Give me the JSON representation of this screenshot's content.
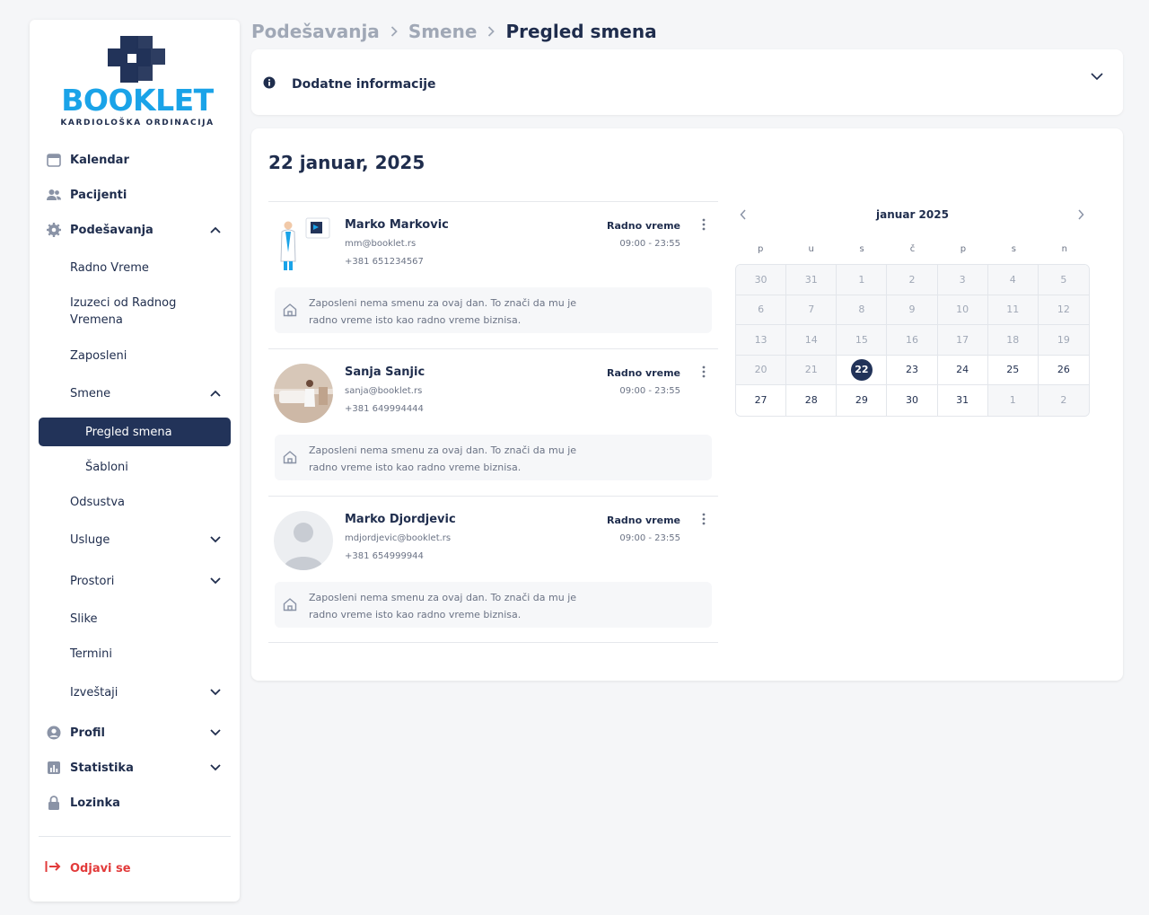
{
  "brand": {
    "name": "BOOKLET",
    "subtitle": "KARDIOLOŠKA ORDINACIJA"
  },
  "sidebar": {
    "kalendar": "Kalendar",
    "pacijenti": "Pacijenti",
    "podesavanja": "Podešavanja",
    "radno_vreme": "Radno Vreme",
    "izuzeci_line1": "Izuzeci od Radnog",
    "izuzeci_line2": "Vremena",
    "zaposleni": "Zaposleni",
    "smene": "Smene",
    "pregled_smena": "Pregled smena",
    "sabloni": "Šabloni",
    "odsustva": "Odsustva",
    "usluge": "Usluge",
    "prostori": "Prostori",
    "slike": "Slike",
    "termini": "Termini",
    "izvestaji": "Izveštaji",
    "profil": "Profil",
    "statistika": "Statistika",
    "lozinka": "Lozinka",
    "odjavi_se": "Odjavi se"
  },
  "breadcrumb": {
    "level1": "Podešavanja",
    "level2": "Smene",
    "current": "Pregled smena"
  },
  "info_panel": {
    "label": "Dodatne informacije"
  },
  "main": {
    "date_title": "22 januar, 2025"
  },
  "employees": [
    {
      "name": "Marko Markovic",
      "email": "mm@booklet.rs",
      "phone": "+381 651234567",
      "work_label": "Radno vreme",
      "work_hours": "09:00 - 23:55",
      "notice": "Zaposleni nema smenu za ovaj dan. To znači da mu je radno vreme isto kao radno vreme biznisa."
    },
    {
      "name": "Sanja Sanjic",
      "email": "sanja@booklet.rs",
      "phone": "+381 649994444",
      "work_label": "Radno vreme",
      "work_hours": "09:00 - 23:55",
      "notice": "Zaposleni nema smenu za ovaj dan. To znači da mu je radno vreme isto kao radno vreme biznisa."
    },
    {
      "name": "Marko Djordjevic",
      "email": "mdjordjevic@booklet.rs",
      "phone": "+381 654999944",
      "work_label": "Radno vreme",
      "work_hours": "09:00 - 23:55",
      "notice": "Zaposleni nema smenu za ovaj dan. To znači da mu je radno vreme isto kao radno vreme biznisa."
    }
  ],
  "calendar": {
    "title": "januar 2025",
    "weekdays": [
      "p",
      "u",
      "s",
      "č",
      "p",
      "s",
      "n"
    ],
    "selected_day": "22",
    "weeks": [
      [
        "30",
        "31",
        "1",
        "2",
        "3",
        "4",
        "5"
      ],
      [
        "6",
        "7",
        "8",
        "9",
        "10",
        "11",
        "12"
      ],
      [
        "13",
        "14",
        "15",
        "16",
        "17",
        "18",
        "19"
      ],
      [
        "20",
        "21",
        "22",
        "23",
        "24",
        "25",
        "26"
      ],
      [
        "27",
        "28",
        "29",
        "30",
        "31",
        "1",
        "2"
      ]
    ]
  },
  "colors": {
    "primary": "#223359",
    "brand_blue": "#1aa3e8",
    "logout_red": "#e23b3b"
  }
}
